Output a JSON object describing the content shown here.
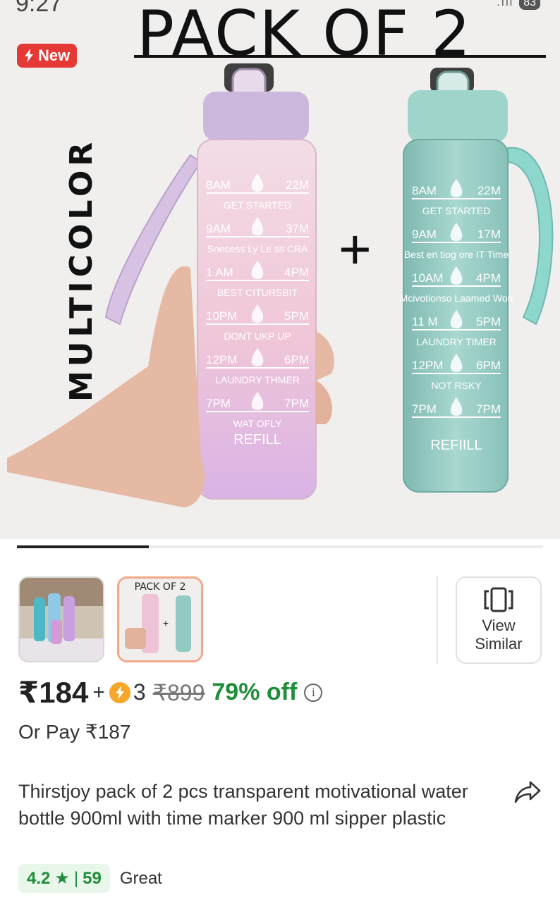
{
  "status_bar": {
    "time": "9:27",
    "battery": "83",
    "signal": ".ıll"
  },
  "hero": {
    "title": "PACK OF 2",
    "badge": "New",
    "side_text": "MULTICOLOR",
    "plus": "+",
    "pink_bottle": {
      "rows": [
        {
          "left": "8AM",
          "right": "22M",
          "caption": "GET STARTED"
        },
        {
          "left": "9AM",
          "right": "37M",
          "caption": "Snecess Ly Le ss CRA"
        },
        {
          "left": "1 AM",
          "right": "4PM",
          "caption": "BEST CITURSBIT"
        },
        {
          "left": "10PM",
          "right": "5PM",
          "caption": "DONT UKP UP"
        },
        {
          "left": "12PM",
          "right": "6PM",
          "caption": "LAUNDRY THMER"
        },
        {
          "left": "7PM",
          "right": "7PM",
          "caption": "WAT OFLY"
        }
      ],
      "footer": "REFILL"
    },
    "green_bottle": {
      "rows": [
        {
          "left": "8AM",
          "right": "22M",
          "caption": "GET STARTED"
        },
        {
          "left": "9AM",
          "right": "17M",
          "caption": "Best en tiog ore IT Time"
        },
        {
          "left": "10AM",
          "right": "4PM",
          "caption": "Mcivotionso Laamed Won"
        },
        {
          "left": "11 M",
          "right": "5PM",
          "caption": "LAUNDRY TIMER"
        },
        {
          "left": "12PM",
          "right": "6PM",
          "caption": "NOT RSKY"
        },
        {
          "left": "7PM",
          "right": "7PM",
          "caption": ""
        }
      ],
      "footer": "REFIILL"
    }
  },
  "carousel": {
    "progress": 0.25
  },
  "thumbnails": [
    {
      "name": "thumbnail-lifestyle"
    },
    {
      "name": "thumbnail-pack-of-2",
      "label": "PACK OF 2"
    }
  ],
  "view_similar": {
    "line1": "View",
    "line2": "Similar"
  },
  "pricing": {
    "current": "₹184",
    "plus": "+",
    "coins": "3",
    "mrp": "₹899",
    "discount": "79% off",
    "info": "i",
    "or_pay": "Or Pay ₹187"
  },
  "product": {
    "title": "Thirstjoy pack of 2 pcs transparent motivational water bottle 900ml with time marker 900 ml sipper plastic"
  },
  "rating": {
    "score": "4.2",
    "star": "★",
    "sep": "|",
    "count": "59",
    "label": "Great"
  },
  "colors": {
    "discount_green": "#1f8d3a",
    "new_badge_red": "#e53935",
    "pink_bottle": "#f2c8dc",
    "green_bottle": "#9ccfc8",
    "coin_orange": "#f6a628"
  }
}
